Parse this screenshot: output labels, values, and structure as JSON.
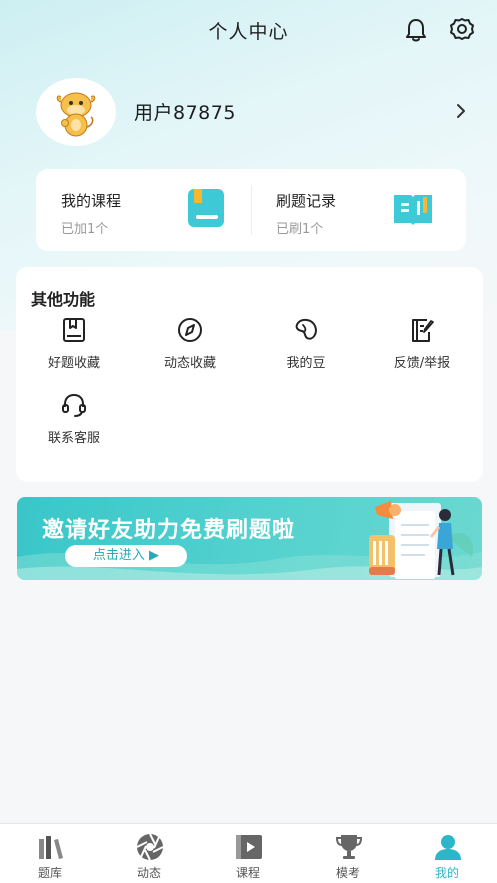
{
  "header": {
    "title": "个人中心"
  },
  "profile": {
    "username": "用户87875"
  },
  "courses": [
    {
      "title": "我的课程",
      "sub": "已加1个"
    },
    {
      "title": "刷题记录",
      "sub": "已刷1个"
    }
  ],
  "functions": {
    "title": "其他功能",
    "items": [
      {
        "label": "好题收藏",
        "icon": "book-icon"
      },
      {
        "label": "动态收藏",
        "icon": "compass-icon"
      },
      {
        "label": "我的豆",
        "icon": "bean-icon"
      },
      {
        "label": "反馈/举报",
        "icon": "feedback-icon"
      },
      {
        "label": "联系客服",
        "icon": "headset-icon"
      }
    ]
  },
  "banner": {
    "title": "邀请好友助力免费刷题啦",
    "button": "点击进入 ▶"
  },
  "tabbar": {
    "items": [
      {
        "label": "题库",
        "icon": "library-icon"
      },
      {
        "label": "动态",
        "icon": "shutter-icon"
      },
      {
        "label": "课程",
        "icon": "video-icon"
      },
      {
        "label": "模考",
        "icon": "trophy-icon"
      },
      {
        "label": "我的",
        "icon": "user-icon",
        "active": true
      }
    ]
  },
  "colors": {
    "accent": "#2cb7c9",
    "banner": "#39c6c9"
  }
}
